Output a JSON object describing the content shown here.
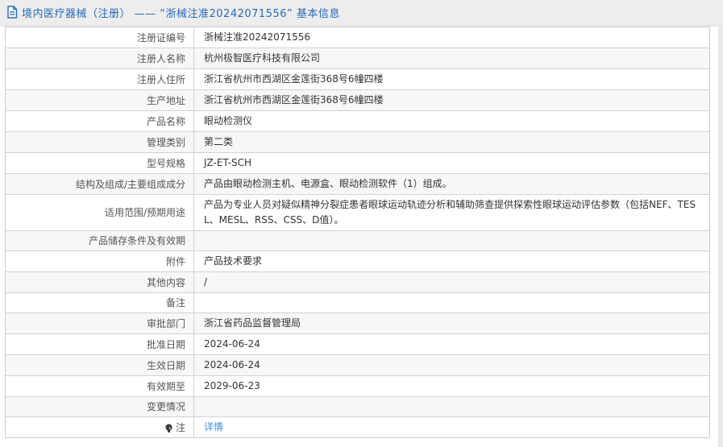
{
  "header": {
    "title": "境内医疗器械（注册） —— “浙械注准20242071556” 基本信息",
    "icon": "document-icon",
    "title_color": "#2569b8"
  },
  "table": {
    "rows": [
      {
        "label": "注册证编号",
        "value": "浙械注准20242071556",
        "value_type": "text"
      },
      {
        "label": "注册人名称",
        "value": "杭州极智医疗科技有限公司",
        "value_type": "text"
      },
      {
        "label": "注册人住所",
        "value": "浙江省杭州市西湖区金莲街368号6幢四楼",
        "value_type": "text"
      },
      {
        "label": "生产地址",
        "value": "浙江省杭州市西湖区金莲街368号6幢四楼",
        "value_type": "text"
      },
      {
        "label": "产品名称",
        "value": "眼动检测仪",
        "value_type": "text"
      },
      {
        "label": "管理类别",
        "value": "第二类",
        "value_type": "text"
      },
      {
        "label": "型号规格",
        "value": "JZ-ET-SCH",
        "value_type": "text"
      },
      {
        "label": "结构及组成/主要组成成分",
        "value": "产品由眼动检测主机、电源盒、眼动检测软件（1）组成。",
        "value_type": "text"
      },
      {
        "label": "适用范围/预期用途",
        "value": "产品为专业人员对疑似精神分裂症患者眼球运动轨迹分析和辅助筛查提供探索性眼球运动评估参数（包括NEF、TESL、MESL、RSS、CSS、D值）。",
        "value_type": "text"
      },
      {
        "label": "产品储存条件及有效期",
        "value": "",
        "value_type": "empty"
      },
      {
        "label": "附件",
        "value": "产品技术要求",
        "value_type": "text"
      },
      {
        "label": "其他内容",
        "value": "/",
        "value_type": "text"
      },
      {
        "label": "备注",
        "value": "",
        "value_type": "empty"
      },
      {
        "label": "审批部门",
        "value": "浙江省药品监督管理局",
        "value_type": "text"
      },
      {
        "label": "批准日期",
        "value": "2024-06-24",
        "value_type": "text"
      },
      {
        "label": "生效日期",
        "value": "2024-06-24",
        "value_type": "text"
      },
      {
        "label": "有效期至",
        "value": "2029-06-23",
        "value_type": "text"
      },
      {
        "label": "变更情况",
        "value": "",
        "value_type": "empty"
      },
      {
        "label": "注",
        "label_icon": "bulb-icon",
        "value": "详情",
        "value_type": "link"
      }
    ]
  },
  "colors": {
    "accent_blue": "#2569b8",
    "link_blue": "#3e8ede",
    "row_alt_bg": "#f7f7f7",
    "border": "#d2d2d2",
    "titlebar_bg": "#ededed",
    "page_bg": "#e9e9e9"
  }
}
